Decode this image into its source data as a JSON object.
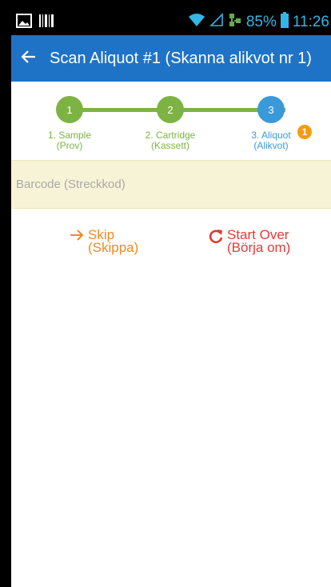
{
  "status_bar": {
    "battery": "85%",
    "time": "11:26"
  },
  "app_bar": {
    "title": "Scan Aliquot #1 (Skanna alikvot nr 1)"
  },
  "stepper": {
    "steps": [
      {
        "number": "1",
        "label": "1. Sample\n(Prov)",
        "state": "completed",
        "color": "#7cb342"
      },
      {
        "number": "2",
        "label": "2. Cartridge\n(Kassett)",
        "state": "completed",
        "color": "#7cb342"
      },
      {
        "number": "3",
        "label": "3. Aliquot\n(Alikvot)",
        "state": "active",
        "color": "#3a9ad9",
        "badge": "1"
      }
    ]
  },
  "barcode_field": {
    "placeholder": "Barcode (Streckkod)"
  },
  "actions": {
    "skip_label": "Skip\n(Skippa)",
    "start_over_label": "Start Over\n(Börja om)"
  },
  "colors": {
    "app_bar": "#1f73c7",
    "skip": "#ef8a22",
    "start_over": "#e53935",
    "barcode_bg": "#f7f3d6"
  }
}
